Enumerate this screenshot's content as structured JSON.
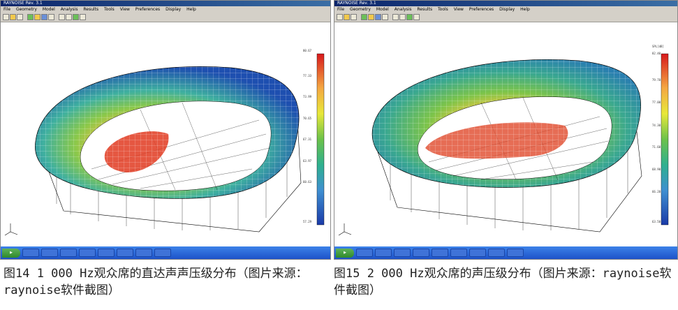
{
  "left": {
    "app_title": "RAYNOISE Rev. 3.1",
    "menu": [
      "File",
      "Geometry",
      "Model",
      "Analysis",
      "Results",
      "Tools",
      "View",
      "Preferences",
      "Display",
      "Help"
    ],
    "scale_values": [
      "80.67",
      "77.33",
      "73.99",
      "70.65",
      "67.31",
      "63.97",
      "60.63",
      "57.29"
    ],
    "colors": {
      "accent": "#0a246a"
    },
    "caption": "图14 1 000 Hz观众席的直达声声压级分布（图片来源：raynoise软件截图）"
  },
  "right": {
    "app_title": "RAYNOISE Rev. 3.1",
    "menu": [
      "File",
      "Geometry",
      "Model",
      "Analysis",
      "Results",
      "Tools",
      "View",
      "Preferences",
      "Display",
      "Help"
    ],
    "scale_values": [
      "82.40",
      "79.70",
      "77.00",
      "74.30",
      "71.60",
      "68.90",
      "66.20",
      "63.50"
    ],
    "scale_unit": "SPL[dB]",
    "caption": "图15 2 000 Hz观众席的声压级分布（图片来源：raynoise软件截图）"
  }
}
